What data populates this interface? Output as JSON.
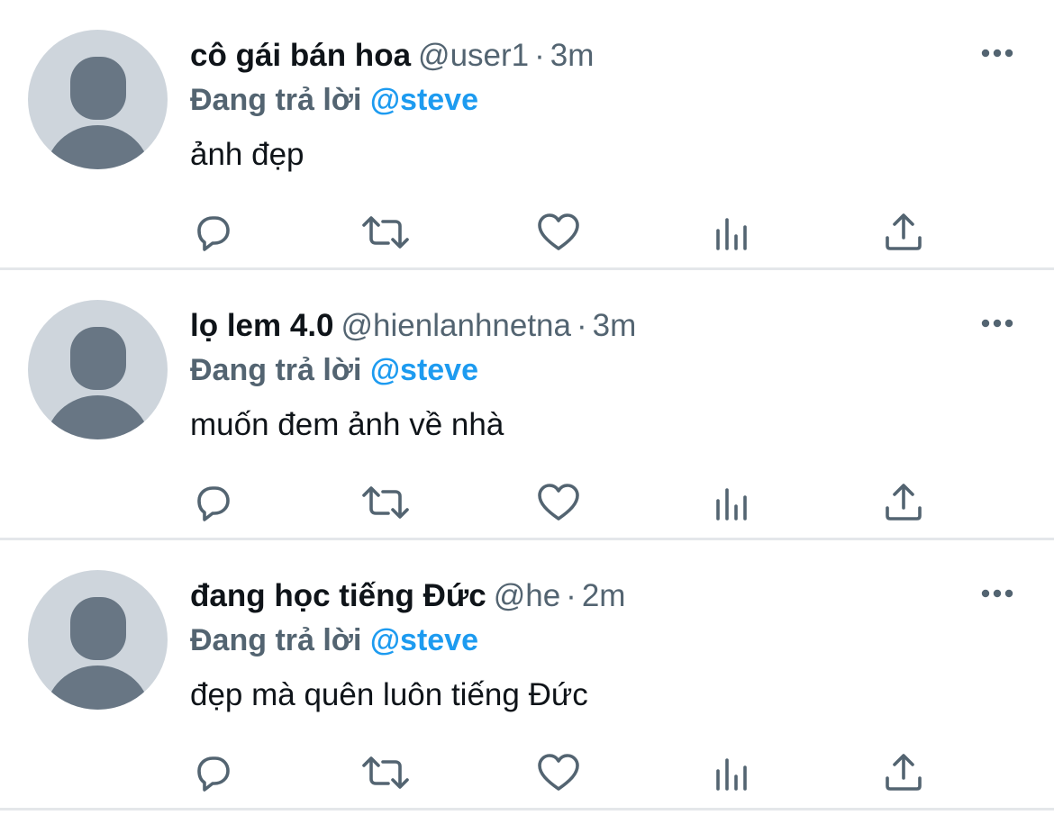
{
  "colors": {
    "text": "#0f1419",
    "secondary": "#536471",
    "accent": "#1d9bf0",
    "avatar_bg": "#ced5dc",
    "avatar_figure": "#687684",
    "divider": "#e4e7ea"
  },
  "icons": {
    "reply": "speech-bubble-icon",
    "retweet": "retweet-icon",
    "like": "heart-icon",
    "views": "bar-chart-icon",
    "share": "share-upload-icon",
    "more": "more-horizontal-icon"
  },
  "tweets": [
    {
      "name": "cô gái bán hoa",
      "handle": "@user1",
      "separator": "·",
      "time": "3m",
      "reply_prefix": "Đang trả lời",
      "reply_to": "@steve",
      "text": "ảnh đẹp"
    },
    {
      "name": "lọ lem 4.0",
      "handle": "@hienlanhnetna",
      "separator": "·",
      "time": "3m",
      "reply_prefix": "Đang trả lời",
      "reply_to": "@steve",
      "text": "muốn đem ảnh về nhà"
    },
    {
      "name": "đang học tiếng Đức",
      "handle": "@he",
      "separator": "·",
      "time": "2m",
      "reply_prefix": "Đang trả lời",
      "reply_to": "@steve",
      "text": "đẹp mà quên luôn tiếng Đức"
    }
  ]
}
